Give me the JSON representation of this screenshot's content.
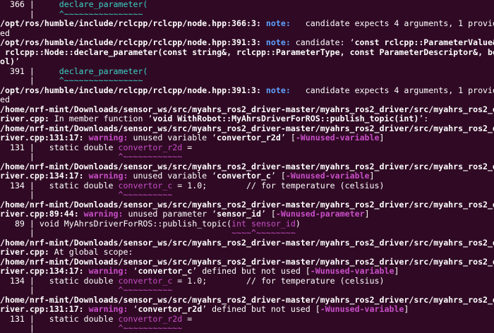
{
  "terminal": {
    "lines": [
      [
        {
          "t": "  366 |     "
        },
        {
          "t": "declare_parameter(",
          "c": "cyan"
        }
      ],
      [
        {
          "t": "      |     "
        },
        {
          "t": "^~~~~~~~~~~~~~~~~",
          "c": "cyan"
        }
      ],
      [
        {
          "t": "/opt/ros/humble/include/rclcpp/rclcpp/node.hpp:366:3: ",
          "c": "b"
        },
        {
          "t": "note:",
          "c": "note"
        },
        {
          "t": "   candidate expects 4 arguments, 1 provid"
        }
      ],
      [
        {
          "t": "ed"
        }
      ],
      [
        {
          "t": "/opt/ros/humble/include/rclcpp/rclcpp/node.hpp:391:3: ",
          "c": "b"
        },
        {
          "t": "note:",
          "c": "note"
        },
        {
          "t": " candidate: ‘"
        },
        {
          "t": "const rclcpp::ParameterValue&",
          "c": "b"
        }
      ],
      [
        {
          "t": " rclcpp::Node::declare_parameter(const string&, rclcpp::ParameterType, const ParameterDescriptor&, bo",
          "c": "b"
        }
      ],
      [
        {
          "t": "ol)",
          "c": "b"
        },
        {
          "t": "’"
        }
      ],
      [
        {
          "t": "  391 |     "
        },
        {
          "t": "declare_parameter(",
          "c": "cyan"
        }
      ],
      [
        {
          "t": "      |     "
        },
        {
          "t": "^~~~~~~~~~~~~~~~~",
          "c": "cyan"
        }
      ],
      [
        {
          "t": "/opt/ros/humble/include/rclcpp/rclcpp/node.hpp:391:3: ",
          "c": "b"
        },
        {
          "t": "note:",
          "c": "note"
        },
        {
          "t": "   candidate expects 4 arguments, 1 provid"
        }
      ],
      [
        {
          "t": "ed"
        }
      ],
      [
        {
          "t": "/home/nrf-mint/Downloads/sensor_ws/src/myahrs_ros2_driver-master/myahrs_ros2_driver/src/myahrs_ros2_d",
          "c": "b"
        }
      ],
      [
        {
          "t": "river.cpp:",
          "c": "b"
        },
        {
          "t": " In member function ‘"
        },
        {
          "t": "void WithRobot::MyAhrsDriverForROS::publish_topic(int)",
          "c": "b"
        },
        {
          "t": "’:"
        }
      ],
      [
        {
          "t": "/home/nrf-mint/Downloads/sensor_ws/src/myahrs_ros2_driver-master/myahrs_ros2_driver/src/myahrs_ros2_d",
          "c": "b"
        }
      ],
      [
        {
          "t": "river.cpp:131:17: ",
          "c": "b"
        },
        {
          "t": "warning:",
          "c": "warn"
        },
        {
          "t": " unused variable ‘"
        },
        {
          "t": "convertor_r2d",
          "c": "b"
        },
        {
          "t": "’ ["
        },
        {
          "t": "-Wunused-variable",
          "c": "flag"
        },
        {
          "t": "]"
        }
      ],
      [
        {
          "t": "  131 |   static double "
        },
        {
          "t": "convertor_r2d",
          "c": "hl"
        },
        {
          "t": " ="
        }
      ],
      [
        {
          "t": "      |                 "
        },
        {
          "t": "^~~~~~~~~~~~~",
          "c": "hl"
        }
      ],
      [
        {
          "t": "/home/nrf-mint/Downloads/sensor_ws/src/myahrs_ros2_driver-master/myahrs_ros2_driver/src/myahrs_ros2_d",
          "c": "b"
        }
      ],
      [
        {
          "t": "river.cpp:134:17: ",
          "c": "b"
        },
        {
          "t": "warning:",
          "c": "warn"
        },
        {
          "t": " unused variable ‘"
        },
        {
          "t": "convertor_c",
          "c": "b"
        },
        {
          "t": "’ ["
        },
        {
          "t": "-Wunused-variable",
          "c": "flag"
        },
        {
          "t": "]"
        }
      ],
      [
        {
          "t": "  134 |   static double "
        },
        {
          "t": "convertor_c",
          "c": "hl"
        },
        {
          "t": " = 1.0;        // for temperature (celsius)"
        }
      ],
      [
        {
          "t": "      |                 "
        },
        {
          "t": "^~~~~~~~~~~",
          "c": "hl"
        }
      ],
      [
        {
          "t": "/home/nrf-mint/Downloads/sensor_ws/src/myahrs_ros2_driver-master/myahrs_ros2_driver/src/myahrs_ros2_d",
          "c": "b"
        }
      ],
      [
        {
          "t": "river.cpp:89:44: ",
          "c": "b"
        },
        {
          "t": "warning:",
          "c": "warn"
        },
        {
          "t": " unused parameter ‘"
        },
        {
          "t": "sensor_id",
          "c": "b"
        },
        {
          "t": "’ ["
        },
        {
          "t": "-Wunused-parameter",
          "c": "flag"
        },
        {
          "t": "]"
        }
      ],
      [
        {
          "t": "   89 | void MyAhrsDriverForROS::publish_topic("
        },
        {
          "t": "int sensor_id",
          "c": "hl"
        },
        {
          "t": ")"
        }
      ],
      [
        {
          "t": "      |                                        "
        },
        {
          "t": "~~~~^~~~~~~~~",
          "c": "hl"
        }
      ],
      [
        {
          "t": "/home/nrf-mint/Downloads/sensor_ws/src/myahrs_ros2_driver-master/myahrs_ros2_driver/src/myahrs_ros2_d",
          "c": "b"
        }
      ],
      [
        {
          "t": "river.cpp:",
          "c": "b"
        },
        {
          "t": " At global scope:"
        }
      ],
      [
        {
          "t": "/home/nrf-mint/Downloads/sensor_ws/src/myahrs_ros2_driver-master/myahrs_ros2_driver/src/myahrs_ros2_d",
          "c": "b"
        }
      ],
      [
        {
          "t": "river.cpp:134:17: ",
          "c": "b"
        },
        {
          "t": "warning:",
          "c": "warn"
        },
        {
          "t": " ‘"
        },
        {
          "t": "convertor_c",
          "c": "b"
        },
        {
          "t": "’ defined but not used ["
        },
        {
          "t": "-Wunused-variable",
          "c": "flag"
        },
        {
          "t": "]"
        }
      ],
      [
        {
          "t": "  134 |   static double "
        },
        {
          "t": "convertor_c",
          "c": "hl"
        },
        {
          "t": " = 1.0;        // for temperature (celsius)"
        }
      ],
      [
        {
          "t": "      |                 "
        },
        {
          "t": "^~~~~~~~~~~",
          "c": "hl"
        }
      ],
      [
        {
          "t": "/home/nrf-mint/Downloads/sensor_ws/src/myahrs_ros2_driver-master/myahrs_ros2_driver/src/myahrs_ros2_d",
          "c": "b"
        }
      ],
      [
        {
          "t": "river.cpp:131:17: ",
          "c": "b"
        },
        {
          "t": "warning:",
          "c": "warn"
        },
        {
          "t": " ‘"
        },
        {
          "t": "convertor_r2d",
          "c": "b"
        },
        {
          "t": "’ defined but not used ["
        },
        {
          "t": "-Wunused-variable",
          "c": "flag"
        },
        {
          "t": "]"
        }
      ],
      [
        {
          "t": "  131 |   static double "
        },
        {
          "t": "convertor_r2d",
          "c": "hl"
        },
        {
          "t": " ="
        }
      ],
      [
        {
          "t": "      |                 "
        },
        {
          "t": "^~~~~~~~~~~~~",
          "c": "hl"
        }
      ]
    ]
  },
  "colors": {
    "background": "#300a24",
    "note": "#5ea0ff",
    "warning": "#c84ec8",
    "code_highlight": "#c84ec8",
    "caret_cyan": "#3bd1c6",
    "text": "#ffffff"
  }
}
